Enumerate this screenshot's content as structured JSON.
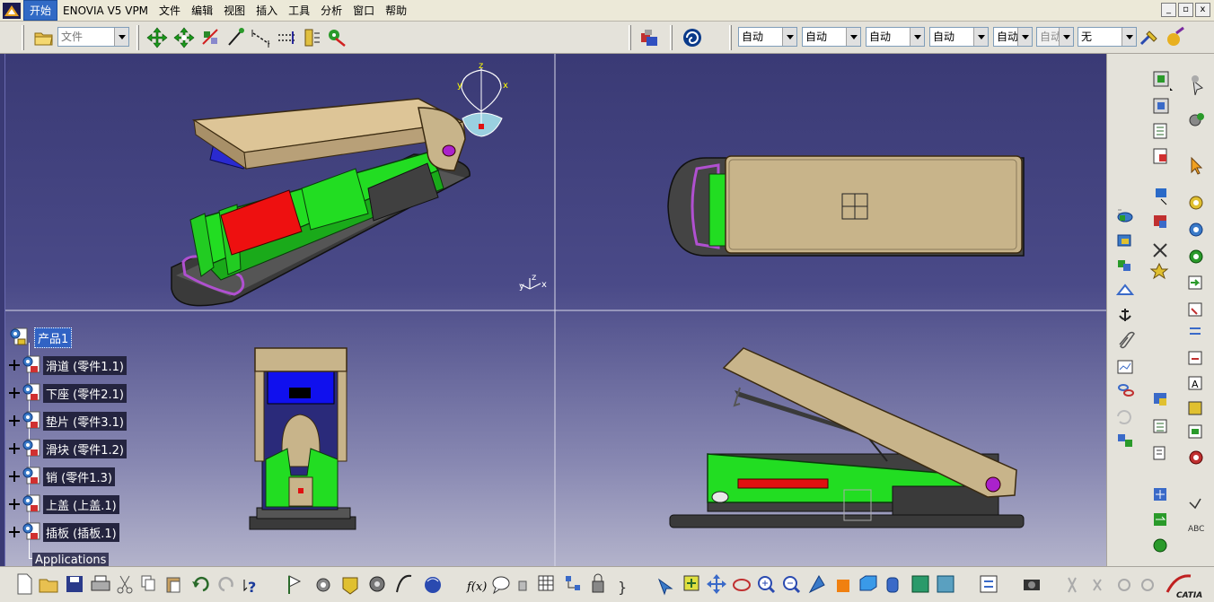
{
  "menubar": {
    "items": [
      "开始",
      "ENOVIA V5 VPM",
      "文件",
      "编辑",
      "视图",
      "插入",
      "工具",
      "分析",
      "窗口",
      "帮助"
    ],
    "window_buttons": [
      "_",
      "▫",
      "x"
    ]
  },
  "toolbar": {
    "filter_combo": "文件",
    "combos": [
      "自动",
      "自动",
      "自动",
      "自动",
      "自动",
      "自动",
      "无"
    ]
  },
  "tree": {
    "root": "产品1",
    "children": [
      "滑道 (零件1.1)",
      "下座 (零件2.1)",
      "垫片 (零件3.1)",
      "滑块 (零件1.2)",
      "销 (零件1.3)",
      "上盖 (上盖.1)",
      "插板 (插板.1)"
    ],
    "applications": "Applications"
  },
  "axes": {
    "compass": {
      "z": "z",
      "y": "y",
      "x": "x"
    },
    "triad": {
      "y": "y",
      "z": "z",
      "x": "x"
    }
  },
  "colors": {
    "viewport_top": "#3a3a75",
    "viewport_bottom": "#b3b3cb",
    "lid": "#c8b48a",
    "slider": "#22dd22",
    "base": "#3a3a3a",
    "pad": "#e01010",
    "insert": "#1010cc",
    "pin": "#aa22cc"
  },
  "footer": {
    "brand": "CATIA"
  }
}
